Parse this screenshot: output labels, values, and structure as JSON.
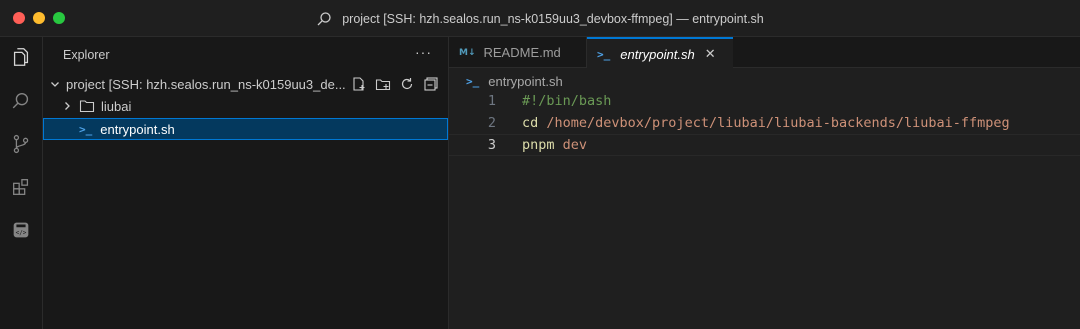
{
  "window": {
    "title": "project [SSH: hzh.sealos.run_ns-k0159uu3_devbox-ffmpeg] — entrypoint.sh"
  },
  "activity_bar": {
    "items": [
      "explorer-icon",
      "search-icon",
      "source-control-icon",
      "extensions-icon",
      "remote-devbox-icon"
    ]
  },
  "sidebar": {
    "title": "Explorer",
    "more": "···",
    "root_label": "project [SSH: hzh.sealos.run_ns-k0159uu3_de...",
    "items": [
      {
        "label": "liubai",
        "type": "folder"
      },
      {
        "label": "entrypoint.sh",
        "type": "file",
        "selected": true
      }
    ]
  },
  "tabs": [
    {
      "label": "README.md",
      "icon": "M↓",
      "active": false
    },
    {
      "label": "entrypoint.sh",
      "icon": ">_",
      "active": true,
      "close": "✕"
    }
  ],
  "breadcrumb": {
    "icon": ">_",
    "label": "entrypoint.sh"
  },
  "editor": {
    "lines": [
      {
        "number": "1",
        "text": "#!/bin/bash"
      },
      {
        "number": "2",
        "cmd": "cd",
        "arg": " /home/devbox/project/liubai/liubai-backends/liubai-ffmpeg"
      },
      {
        "number": "3",
        "cmd": "pnpm",
        "arg": " dev"
      }
    ]
  },
  "colors": {
    "accent": "#0078d4",
    "selection": "#04395e",
    "comment": "#6a9955",
    "command": "#dcdcaa",
    "string": "#ce9178"
  }
}
